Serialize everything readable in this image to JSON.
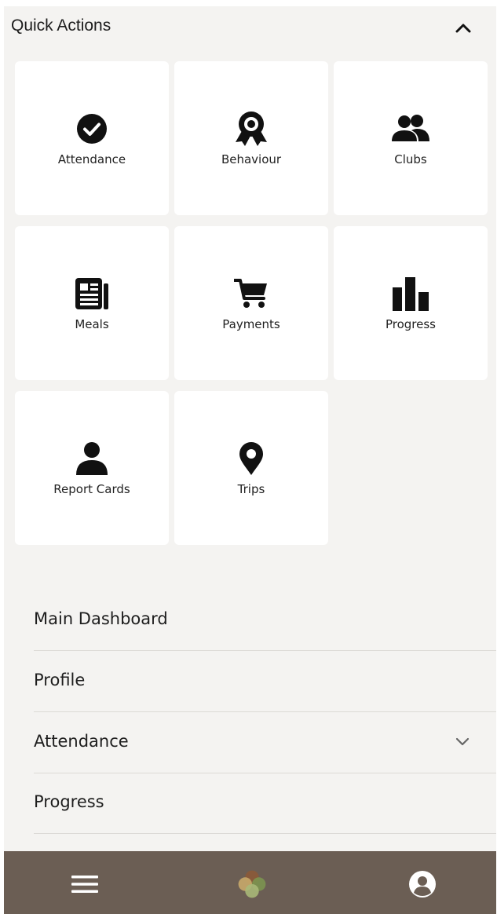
{
  "quick_actions": {
    "title": "Quick Actions",
    "toggle_icon": "chevron-up-icon",
    "tiles": [
      {
        "label": "Attendance",
        "icon": "check-circle-icon"
      },
      {
        "label": "Behaviour",
        "icon": "award-ribbon-icon"
      },
      {
        "label": "Clubs",
        "icon": "users-icon"
      },
      {
        "label": "Meals",
        "icon": "newspaper-icon"
      },
      {
        "label": "Payments",
        "icon": "shopping-cart-icon"
      },
      {
        "label": "Progress",
        "icon": "bar-chart-icon"
      },
      {
        "label": "Report Cards",
        "icon": "user-icon"
      },
      {
        "label": "Trips",
        "icon": "map-marker-icon"
      }
    ]
  },
  "menu": {
    "items": [
      {
        "label": "Main Dashboard"
      },
      {
        "label": "Profile"
      },
      {
        "label": "Attendance",
        "icon": "chevron-down-icon"
      },
      {
        "label": "Progress"
      }
    ]
  },
  "bottom_bar": {
    "left_icon": "hamburger-menu-icon",
    "center_icon": "clover-logo-icon",
    "right_icon": "user-circle-icon"
  },
  "colors": {
    "background": "#f4f3f1",
    "tile": "#ffffff",
    "bottom_bar": "#6b5e54",
    "icon": "#111111"
  }
}
